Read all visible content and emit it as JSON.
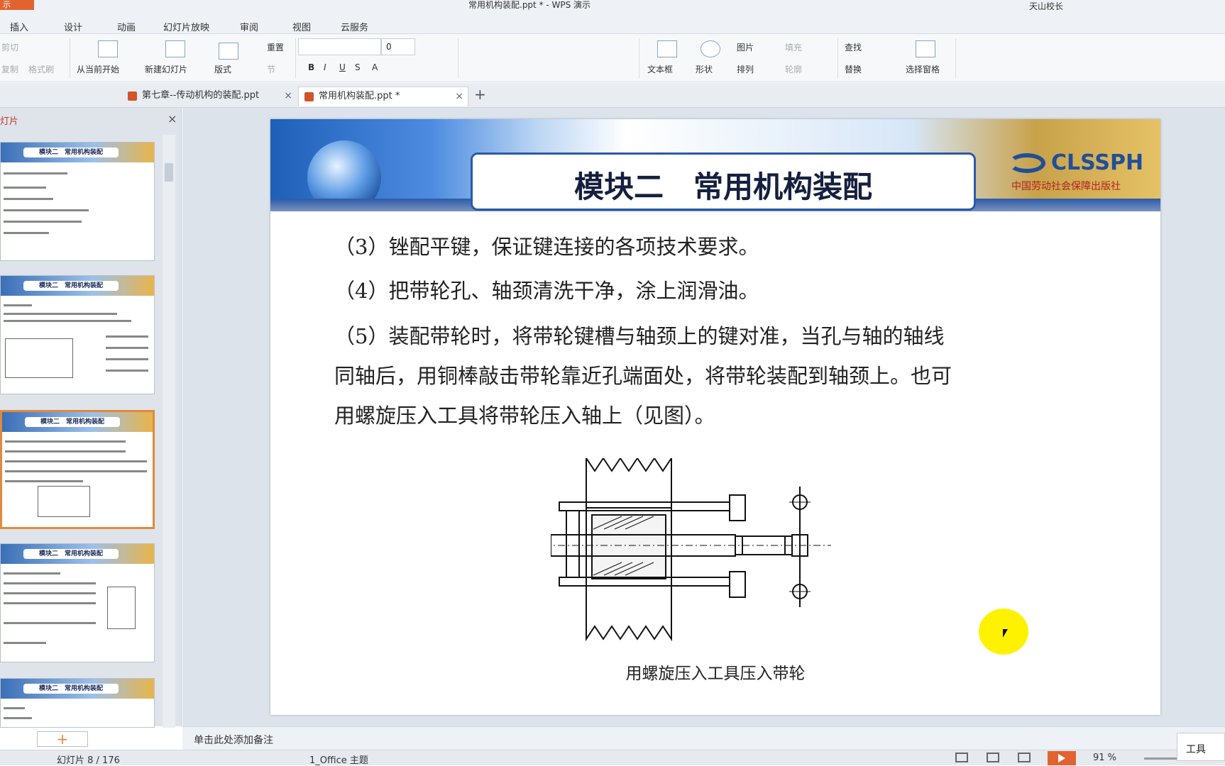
{
  "window": {
    "app_button": "示",
    "title": "常用机构装配.ppt * - WPS 演示",
    "user": "天山校长"
  },
  "menu": [
    "插入",
    "设计",
    "动画",
    "幻灯片放映",
    "审阅",
    "视图",
    "云服务"
  ],
  "ribbon": {
    "cut": "剪切",
    "copy": "复制",
    "format_painter": "格式刷",
    "from_current": "从当前开始",
    "new_slide": "新建幻灯片",
    "layout": "版式",
    "reset": "重置",
    "section": "节",
    "font_size": "0",
    "text_box": "文本框",
    "shapes": "形状",
    "picture": "图片",
    "fill": "填充",
    "arrange": "排列",
    "outline": "轮廓",
    "find": "查找",
    "replace": "替换",
    "selection_pane": "选择窗格"
  },
  "tabs": [
    {
      "label": "第七章--传动机构的装配.ppt"
    },
    {
      "label": "常用机构装配.ppt *"
    }
  ],
  "panel": {
    "title": "灯片",
    "thumb_title": "模块二　常用机构装配"
  },
  "slide": {
    "title": "模块二　常用机构装配",
    "logo_text": "CLSSPH",
    "logo_sub": "中国劳动社会保障出版社",
    "paragraphs": [
      "（3）锉配平键，保证键连接的各项技术要求。",
      "（4）把带轮孔、轴颈清洗干净，涂上润滑油。",
      "（5）装配带轮时，将带轮键槽与轴颈上的键对准，当孔与轴的轴线",
      "同轴后，用铜棒敲击带轮靠近孔端面处，将带轮装配到轴颈上。也可",
      "用螺旋压入工具将带轮压入轴上（见图）。"
    ],
    "caption": "用螺旋压入工具压入带轮"
  },
  "notes_placeholder": "单击此处添加备注",
  "status": {
    "slide_counter": "幻灯片 8 / 176",
    "theme": "1_Office 主题",
    "zoom": "91 %",
    "tools": "工具"
  }
}
